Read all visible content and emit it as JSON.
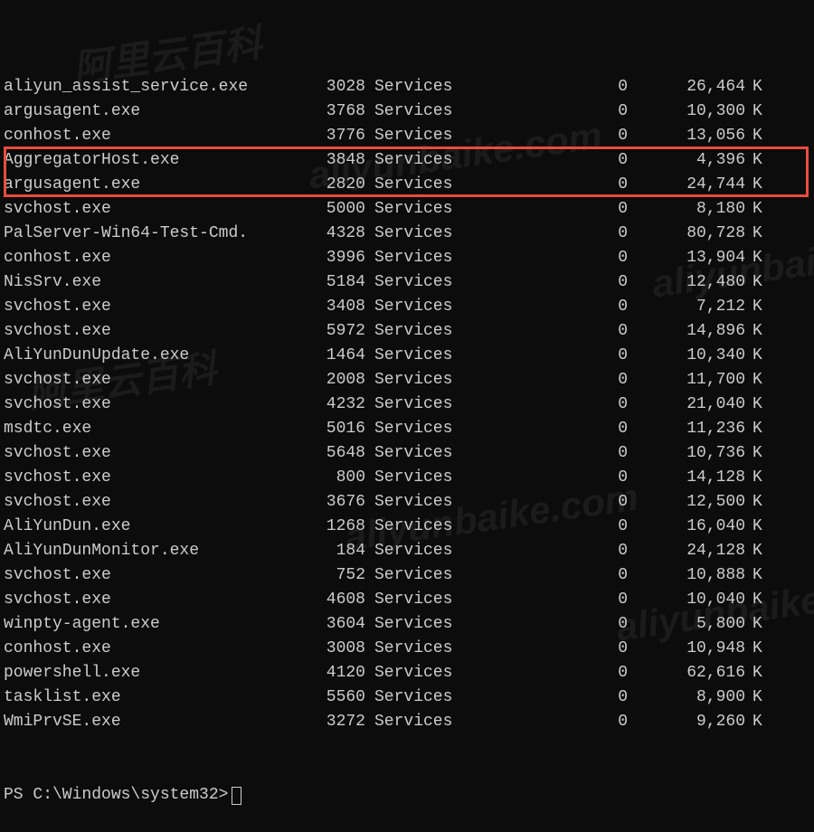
{
  "processes": [
    {
      "name": "aliyun_assist_service.exe",
      "pid": "3028",
      "session": "Services",
      "sessnum": "0",
      "mem": "26,464",
      "unit": "K"
    },
    {
      "name": "argusagent.exe",
      "pid": "3768",
      "session": "Services",
      "sessnum": "0",
      "mem": "10,300",
      "unit": "K"
    },
    {
      "name": "conhost.exe",
      "pid": "3776",
      "session": "Services",
      "sessnum": "0",
      "mem": "13,056",
      "unit": "K"
    },
    {
      "name": "AggregatorHost.exe",
      "pid": "3848",
      "session": "Services",
      "sessnum": "0",
      "mem": "4,396",
      "unit": "K"
    },
    {
      "name": "argusagent.exe",
      "pid": "2820",
      "session": "Services",
      "sessnum": "0",
      "mem": "24,744",
      "unit": "K"
    },
    {
      "name": "svchost.exe",
      "pid": "5000",
      "session": "Services",
      "sessnum": "0",
      "mem": "8,180",
      "unit": "K"
    },
    {
      "name": "PalServer-Win64-Test-Cmd.",
      "pid": "4328",
      "session": "Services",
      "sessnum": "0",
      "mem": "80,728",
      "unit": "K"
    },
    {
      "name": "conhost.exe",
      "pid": "3996",
      "session": "Services",
      "sessnum": "0",
      "mem": "13,904",
      "unit": "K"
    },
    {
      "name": "NisSrv.exe",
      "pid": "5184",
      "session": "Services",
      "sessnum": "0",
      "mem": "12,480",
      "unit": "K"
    },
    {
      "name": "svchost.exe",
      "pid": "3408",
      "session": "Services",
      "sessnum": "0",
      "mem": "7,212",
      "unit": "K"
    },
    {
      "name": "svchost.exe",
      "pid": "5972",
      "session": "Services",
      "sessnum": "0",
      "mem": "14,896",
      "unit": "K"
    },
    {
      "name": "AliYunDunUpdate.exe",
      "pid": "1464",
      "session": "Services",
      "sessnum": "0",
      "mem": "10,340",
      "unit": "K"
    },
    {
      "name": "svchost.exe",
      "pid": "2008",
      "session": "Services",
      "sessnum": "0",
      "mem": "11,700",
      "unit": "K"
    },
    {
      "name": "svchost.exe",
      "pid": "4232",
      "session": "Services",
      "sessnum": "0",
      "mem": "21,040",
      "unit": "K"
    },
    {
      "name": "msdtc.exe",
      "pid": "5016",
      "session": "Services",
      "sessnum": "0",
      "mem": "11,236",
      "unit": "K"
    },
    {
      "name": "svchost.exe",
      "pid": "5648",
      "session": "Services",
      "sessnum": "0",
      "mem": "10,736",
      "unit": "K"
    },
    {
      "name": "svchost.exe",
      "pid": "800",
      "session": "Services",
      "sessnum": "0",
      "mem": "14,128",
      "unit": "K"
    },
    {
      "name": "svchost.exe",
      "pid": "3676",
      "session": "Services",
      "sessnum": "0",
      "mem": "12,500",
      "unit": "K"
    },
    {
      "name": "AliYunDun.exe",
      "pid": "1268",
      "session": "Services",
      "sessnum": "0",
      "mem": "16,040",
      "unit": "K"
    },
    {
      "name": "AliYunDunMonitor.exe",
      "pid": "184",
      "session": "Services",
      "sessnum": "0",
      "mem": "24,128",
      "unit": "K"
    },
    {
      "name": "svchost.exe",
      "pid": "752",
      "session": "Services",
      "sessnum": "0",
      "mem": "10,888",
      "unit": "K"
    },
    {
      "name": "svchost.exe",
      "pid": "4608",
      "session": "Services",
      "sessnum": "0",
      "mem": "10,040",
      "unit": "K"
    },
    {
      "name": "winpty-agent.exe",
      "pid": "3604",
      "session": "Services",
      "sessnum": "0",
      "mem": "5,800",
      "unit": "K"
    },
    {
      "name": "conhost.exe",
      "pid": "3008",
      "session": "Services",
      "sessnum": "0",
      "mem": "10,948",
      "unit": "K"
    },
    {
      "name": "powershell.exe",
      "pid": "4120",
      "session": "Services",
      "sessnum": "0",
      "mem": "62,616",
      "unit": "K"
    },
    {
      "name": "tasklist.exe",
      "pid": "5560",
      "session": "Services",
      "sessnum": "0",
      "mem": "8,900",
      "unit": "K"
    },
    {
      "name": "WmiPrvSE.exe",
      "pid": "3272",
      "session": "Services",
      "sessnum": "0",
      "mem": "9,260",
      "unit": "K"
    }
  ],
  "prompt": "PS C:\\Windows\\system32>",
  "watermark_cn": "阿里云百科",
  "watermark_en": "aliyunbaike.com"
}
